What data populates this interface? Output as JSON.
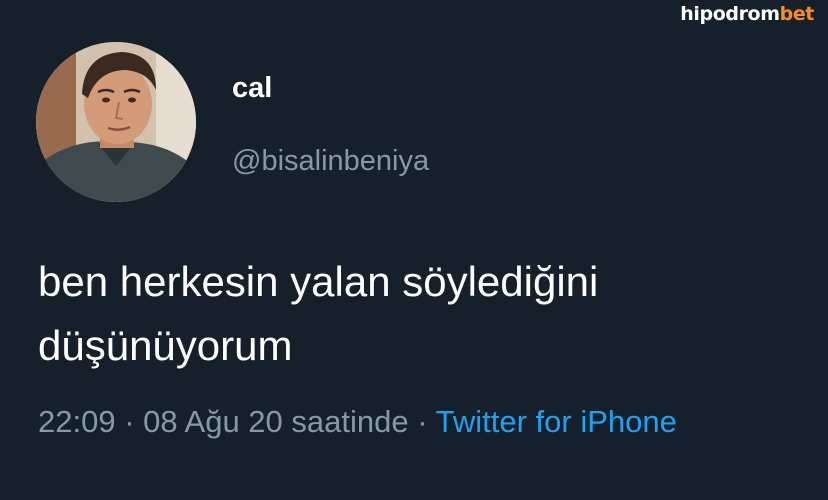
{
  "watermark": {
    "main": "hipodrom",
    "accent": "bet",
    "accent_color": "#ff8c1a"
  },
  "user": {
    "display_name": "cal",
    "handle": "@bisalinbeniya",
    "avatar_icon": "profile-photo"
  },
  "tweet": {
    "text_line_1": "ben herkesin yalan söylediğini",
    "text_line_2": "düşünüyorum",
    "time": "22:09",
    "separator": "·",
    "date_text": "08 Ağu 20 saatinde",
    "source": "Twitter for iPhone"
  },
  "colors": {
    "background": "#15202b",
    "secondary_text": "#8899a6",
    "link": "#1da1f2"
  }
}
